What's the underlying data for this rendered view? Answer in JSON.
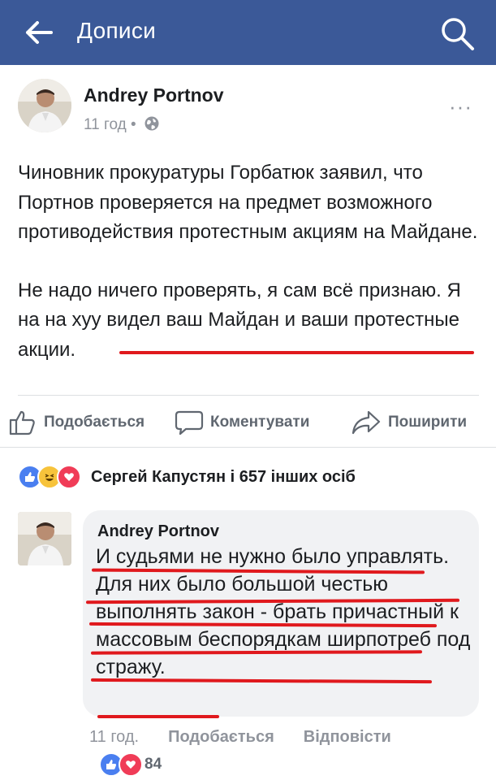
{
  "header": {
    "title": "Дописи",
    "back_icon": "back-arrow-icon",
    "search_icon": "search-icon",
    "bar_color": "#3b5998"
  },
  "post": {
    "author": "Andrey Portnov",
    "time": "11 год",
    "separator": "•",
    "privacy_icon": "globe-icon",
    "more_label": "···",
    "paragraph1": "Чиновник прокуратуры Горбатюк заявил, что Портнов проверяется на предмет возможного противодействия протестным акциям на Майдане.",
    "paragraph2": "Не надо ничего проверять, я сам всё признаю. Я на на хуу видел ваш Майдан и ваши протестные акции."
  },
  "actions": {
    "like": "Подобається",
    "comment": "Коментувати",
    "share": "Поширити"
  },
  "reactions": {
    "summary": "Сергей Капустян і 657 інших осіб",
    "icons": [
      "like-reaction-icon",
      "haha-reaction-icon",
      "love-reaction-icon"
    ]
  },
  "comment": {
    "author": "Andrey Portnov",
    "text": "И судьями не нужно было управлять. Для них было большой честью выполнять закон - брать причастный к массовым беспорядкам ширпотреб под стражу.",
    "time": "11 год.",
    "like": "Подобається",
    "reply": "Відповісти",
    "reaction_count": "84"
  },
  "colors": {
    "accent": "#3b5998",
    "highlight": "#e0191d",
    "bubble": "#f1f2f4"
  }
}
